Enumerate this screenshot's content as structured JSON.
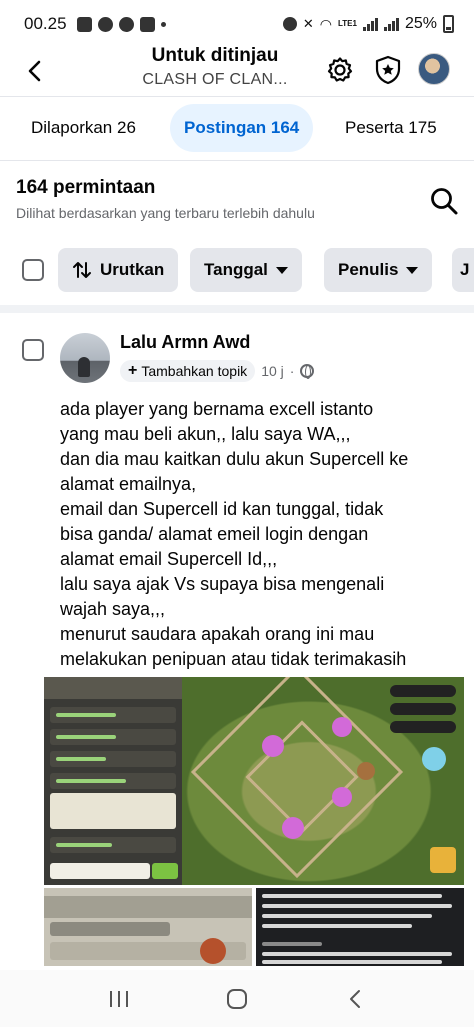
{
  "status_bar": {
    "time": "00.25",
    "battery": "25%",
    "network": "LTE1"
  },
  "header": {
    "title": "Untuk ditinjau",
    "subtitle": "CLASH OF CLAN..."
  },
  "tabs": [
    {
      "label": "Dilaporkan 26",
      "active": false
    },
    {
      "label": "Postingan 164",
      "active": true
    },
    {
      "label": "Peserta 175",
      "active": false
    }
  ],
  "list": {
    "count_title": "164 permintaan",
    "sort_subtitle": "Dilihat berdasarkan yang terbaru terlebih dahulu"
  },
  "filters": {
    "sort": "Urutkan",
    "date": "Tanggal",
    "author": "Penulis",
    "more": "J"
  },
  "post": {
    "author": "Lalu Armn Awd",
    "add_topic": "Tambahkan topik",
    "time": "10 j",
    "lines": [
      "ada player yang bernama excell istanto",
      "yang mau beli akun,, lalu saya WA,,,",
      "dan dia mau kaitkan dulu akun Supercell ke",
      "alamat emailnya,",
      "email dan Supercell id kan tunggal, tidak",
      "bisa ganda/ alamat emeil login dengan",
      "alamat email Supercell Id,,,",
      "lalu saya ajak Vs supaya bisa mengenali",
      "wajah saya,,,",
      "menurut saudara apakah orang ini mau",
      "melakukan penipuan atau tidak terimakasih"
    ]
  },
  "colors": {
    "accent": "#0064d1",
    "active_tab_bg": "#e7f3ff",
    "chip_bg": "#e4e6eb"
  }
}
